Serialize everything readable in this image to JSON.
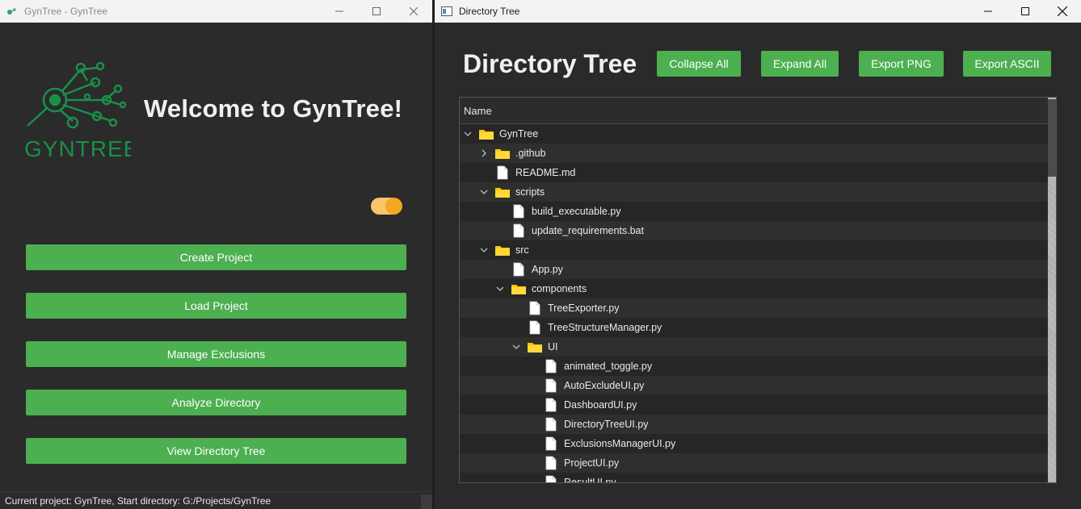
{
  "left_window": {
    "title": "GynTree - GynTree",
    "logo_text": "GYNTREE",
    "welcome": "Welcome to GynTree!",
    "theme_toggle_on": true,
    "buttons": {
      "create": "Create Project",
      "load": "Load Project",
      "manage": "Manage Exclusions",
      "analyze": "Analyze Directory",
      "view": "View Directory Tree"
    },
    "status": "Current project: GynTree, Start directory: G:/Projects/GynTree"
  },
  "right_window": {
    "title": "Directory Tree",
    "heading": "Directory Tree",
    "actions": {
      "collapse": "Collapse All",
      "expand": "Expand All",
      "export_png": "Export PNG",
      "export_ascii": "Export ASCII"
    },
    "tree": {
      "column": "Name",
      "rows": [
        {
          "label": "GynTree",
          "type": "folder",
          "depth": 0,
          "state": "expanded"
        },
        {
          "label": ".github",
          "type": "folder",
          "depth": 1,
          "state": "collapsed"
        },
        {
          "label": "README.md",
          "type": "file",
          "depth": 1
        },
        {
          "label": "scripts",
          "type": "folder",
          "depth": 1,
          "state": "expanded"
        },
        {
          "label": "build_executable.py",
          "type": "file",
          "depth": 2
        },
        {
          "label": "update_requirements.bat",
          "type": "file",
          "depth": 2
        },
        {
          "label": "src",
          "type": "folder",
          "depth": 1,
          "state": "expanded"
        },
        {
          "label": "App.py",
          "type": "file",
          "depth": 2
        },
        {
          "label": "components",
          "type": "folder",
          "depth": 2,
          "state": "expanded"
        },
        {
          "label": "TreeExporter.py",
          "type": "file",
          "depth": 3
        },
        {
          "label": "TreeStructureManager.py",
          "type": "file",
          "depth": 3
        },
        {
          "label": "UI",
          "type": "folder",
          "depth": 3,
          "state": "expanded"
        },
        {
          "label": "animated_toggle.py",
          "type": "file",
          "depth": 4
        },
        {
          "label": "AutoExcludeUI.py",
          "type": "file",
          "depth": 4
        },
        {
          "label": "DashboardUI.py",
          "type": "file",
          "depth": 4
        },
        {
          "label": "DirectoryTreeUI.py",
          "type": "file",
          "depth": 4
        },
        {
          "label": "ExclusionsManagerUI.py",
          "type": "file",
          "depth": 4
        },
        {
          "label": "ProjectUI.py",
          "type": "file",
          "depth": 4
        },
        {
          "label": "ResultUI.py",
          "type": "file",
          "depth": 4
        }
      ]
    }
  },
  "colors": {
    "accent_green": "#4caf50",
    "folder_yellow": "#ffc800",
    "logo_green": "#1a8f4a",
    "toggle_track": "#f7c56a",
    "toggle_knob": "#f5a623"
  }
}
